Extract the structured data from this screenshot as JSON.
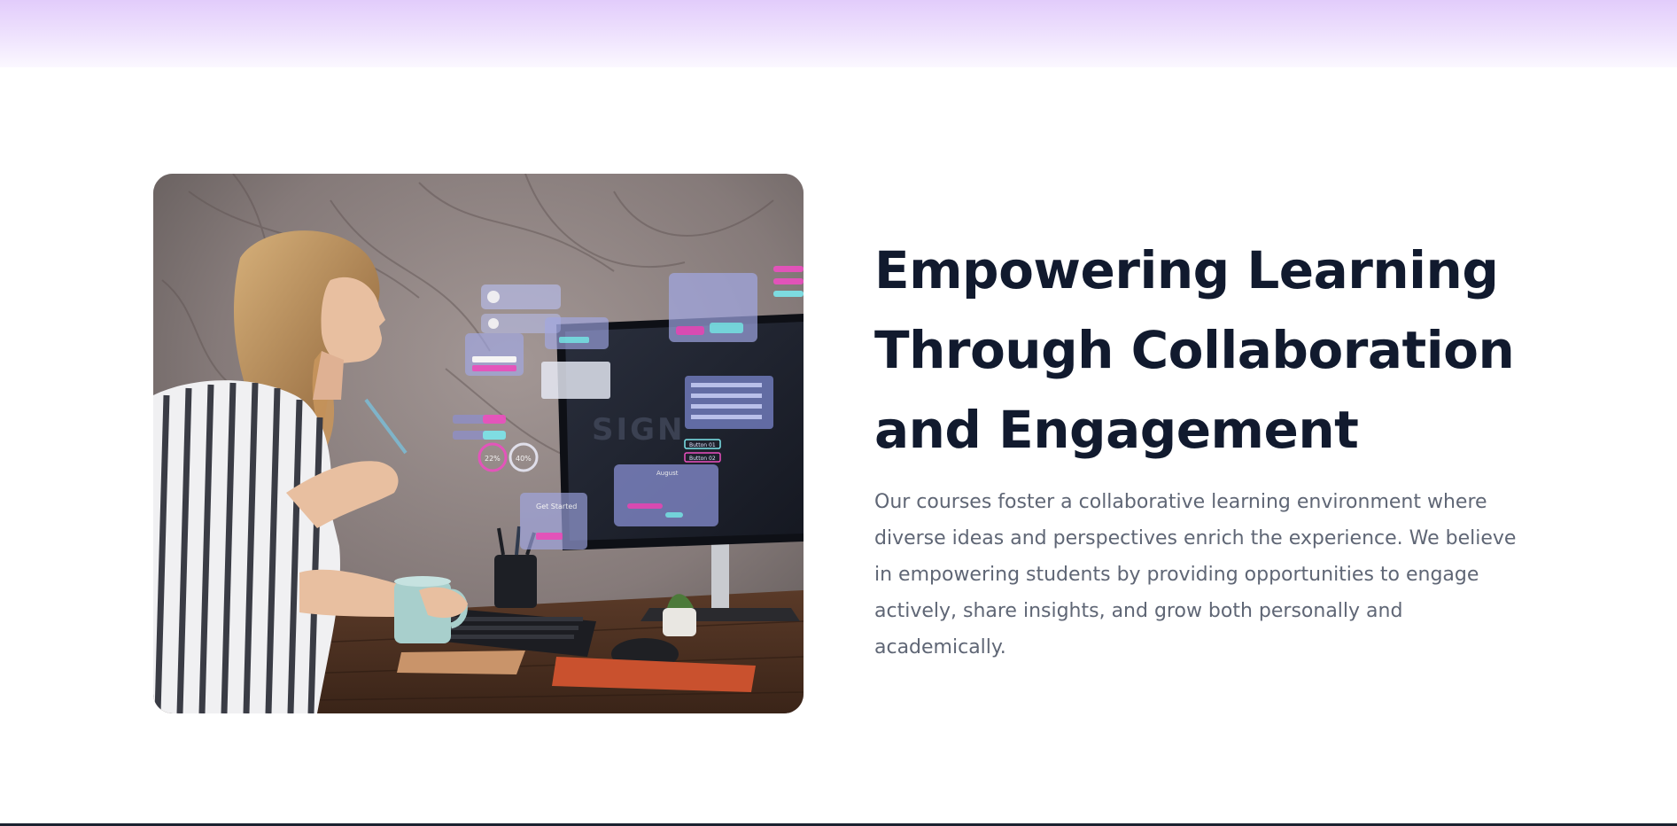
{
  "hero": {
    "title": "Empowering Learning Through Collaboration and Engagement",
    "description": "Our courses foster a collaborative learning environment where diverse ideas and perspectives enrich the experience. We believe in empowering students by providing opportunities to engage actively, share insights, and grow both personally and academically.",
    "image": {
      "screen_text": "SIGN",
      "monitor_buttons": [
        "Button 01",
        "Button 02"
      ],
      "calendar_title": "August",
      "card_title": "Get Started",
      "gauges": [
        "22%",
        "40%"
      ]
    }
  },
  "colors": {
    "title": "#111a2e",
    "body": "#5f6675",
    "accent_pink": "#ec4fc0",
    "accent_cyan": "#7de6ec",
    "band": "#e2ccfb"
  }
}
